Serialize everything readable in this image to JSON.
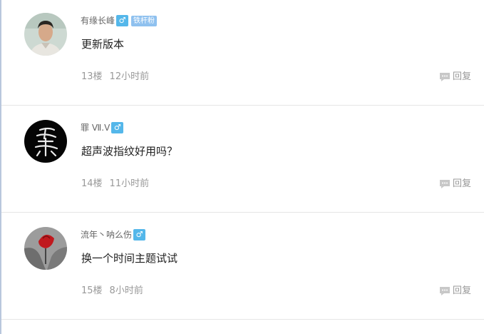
{
  "posts": [
    {
      "username": "有缘长峰",
      "gender": "♂",
      "badge": "铁杆粉",
      "content": "更新版本",
      "floor": "13楼",
      "time": "12小时前",
      "reply_label": "回复"
    },
    {
      "username": "罪 Ⅶ.Ⅴ",
      "gender": "♂",
      "content": "超声波指纹好用吗？",
      "floor": "14楼",
      "time": "11小时前",
      "reply_label": "回复"
    },
    {
      "username": "流年丶呐么伤",
      "gender": "♂",
      "content": "换一个时间主题试试",
      "floor": "15楼",
      "time": "8小时前",
      "reply_label": "回复"
    }
  ],
  "colors": {
    "gender_badge": "#54b7ea",
    "fan_badge": "#8fc1ef",
    "divider": "#e6e6e6"
  }
}
